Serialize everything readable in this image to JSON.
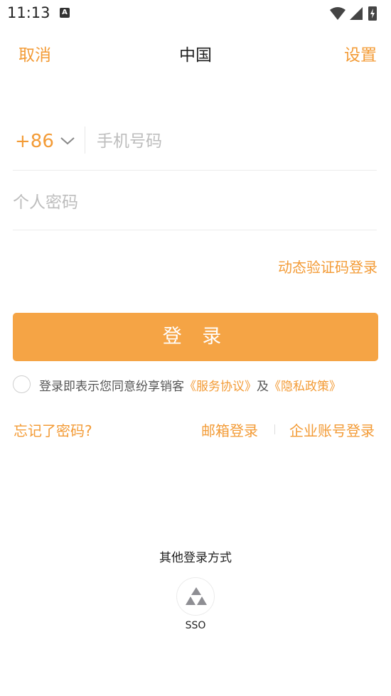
{
  "status_bar": {
    "time": "11:13",
    "notification_icon_letter": "A"
  },
  "nav": {
    "cancel_label": "取消",
    "title": "中国",
    "settings_label": "设置"
  },
  "login_form": {
    "country_code": "+86",
    "phone_placeholder": "手机号码",
    "phone_value": "",
    "password_placeholder": "个人密码",
    "password_value": "",
    "otp_login_label": "动态验证码登录",
    "login_button_label": "登 录"
  },
  "agreement": {
    "checked": false,
    "prefix_text": "登录即表示您同意纷享销客",
    "service_link": "《服务协议》",
    "conjunction": "及",
    "privacy_link": "《隐私政策》"
  },
  "links": {
    "forgot_password": "忘记了密码?",
    "email_login": "邮箱登录",
    "enterprise_login": "企业账号登录"
  },
  "other_login": {
    "title": "其他登录方式",
    "sso_label": "SSO",
    "sso_icon": "sso-triangle-icon"
  },
  "colors": {
    "accent": "#f39b36",
    "button_bg": "#f5a445",
    "placeholder": "#bdbdbd",
    "divider": "#ececec"
  }
}
